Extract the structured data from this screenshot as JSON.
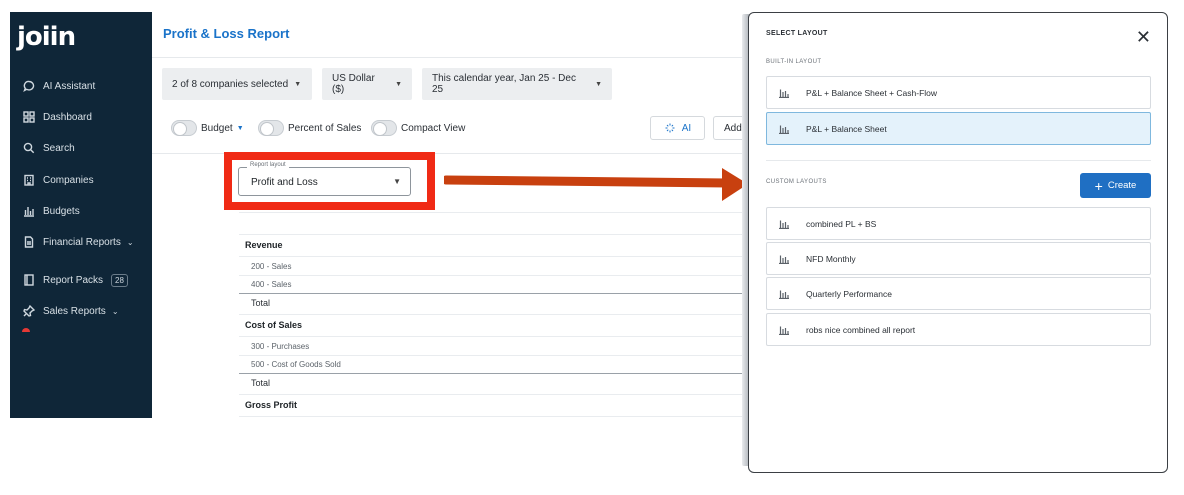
{
  "sidebar": {
    "logo": "joiin",
    "items": [
      {
        "label": "AI Assistant",
        "icon": "chat-bubble-icon"
      },
      {
        "label": "Dashboard",
        "icon": "grid-icon"
      },
      {
        "label": "Search",
        "icon": "search-icon"
      },
      {
        "label": "Companies",
        "icon": "building-icon"
      },
      {
        "label": "Budgets",
        "icon": "bar-chart-icon"
      },
      {
        "label": "Financial Reports",
        "icon": "document-icon"
      },
      {
        "label": "Report Packs",
        "icon": "book-icon",
        "badge": "28"
      },
      {
        "label": "Sales Reports",
        "icon": "pin-icon"
      }
    ]
  },
  "header": {
    "title": "Profit & Loss Report"
  },
  "filters": {
    "companies": "2 of 8 companies selected",
    "currency": "US Dollar ($)",
    "period": "This calendar year, Jan 25 - Dec 25"
  },
  "toggles": {
    "budget": "Budget",
    "percent_of_sales": "Percent of Sales",
    "compact_view": "Compact View"
  },
  "actions": {
    "ai": "AI",
    "add": "Add"
  },
  "report_layout": {
    "legend": "Report layout",
    "value": "Profit and Loss"
  },
  "table": {
    "rows": [
      {
        "label": "Revenue",
        "type": "section"
      },
      {
        "label": "200 - Sales",
        "type": "item"
      },
      {
        "label": "400 - Sales",
        "type": "item"
      },
      {
        "label": "Total",
        "type": "total"
      },
      {
        "label": "Cost of Sales",
        "type": "section"
      },
      {
        "label": "300 - Purchases",
        "type": "item"
      },
      {
        "label": "500 - Cost of Goods Sold",
        "type": "item"
      },
      {
        "label": "Total",
        "type": "total"
      },
      {
        "label": "Gross Profit",
        "type": "section"
      }
    ]
  },
  "panel": {
    "title": "SELECT LAYOUT",
    "built_in_heading": "BUILT-IN LAYOUT",
    "built_in": [
      {
        "label": "P&L + Balance Sheet + Cash-Flow",
        "selected": false
      },
      {
        "label": "P&L + Balance Sheet",
        "selected": true
      }
    ],
    "custom_heading": "CUSTOM LAYOUTS",
    "create_label": "Create",
    "custom": [
      {
        "label": "combined PL + BS"
      },
      {
        "label": "NFD Monthly"
      },
      {
        "label": "Quarterly Performance"
      },
      {
        "label": "robs nice combined all report"
      }
    ]
  },
  "colors": {
    "sidebar_bg": "#0f2638",
    "accent_blue": "#1a73c9",
    "highlight_red": "#f02a15",
    "arrow": "#c8400f",
    "selected_bg": "#e4f2fb"
  }
}
